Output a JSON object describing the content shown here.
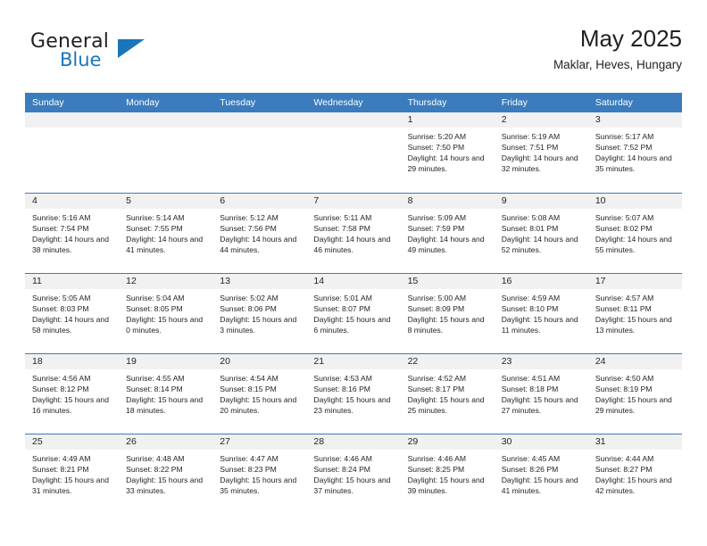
{
  "brand": {
    "line1": "General",
    "line2": "Blue",
    "logo_icon": "blue-triangle-flag-icon",
    "accent_color": "#1b75bb"
  },
  "header": {
    "title": "May 2025",
    "subtitle": "Maklar, Heves, Hungary"
  },
  "theme": {
    "header_blue": "#3a7cbe",
    "date_band": "#f1f1f1",
    "text": "#231f20"
  },
  "calendar": {
    "weekdays": [
      "Sunday",
      "Monday",
      "Tuesday",
      "Wednesday",
      "Thursday",
      "Friday",
      "Saturday"
    ],
    "weeks": [
      [
        {
          "day": ""
        },
        {
          "day": ""
        },
        {
          "day": ""
        },
        {
          "day": ""
        },
        {
          "day": "1",
          "sunrise": "Sunrise: 5:20 AM",
          "sunset": "Sunset: 7:50 PM",
          "daylight": "Daylight: 14 hours and 29 minutes."
        },
        {
          "day": "2",
          "sunrise": "Sunrise: 5:19 AM",
          "sunset": "Sunset: 7:51 PM",
          "daylight": "Daylight: 14 hours and 32 minutes."
        },
        {
          "day": "3",
          "sunrise": "Sunrise: 5:17 AM",
          "sunset": "Sunset: 7:52 PM",
          "daylight": "Daylight: 14 hours and 35 minutes."
        }
      ],
      [
        {
          "day": "4",
          "sunrise": "Sunrise: 5:16 AM",
          "sunset": "Sunset: 7:54 PM",
          "daylight": "Daylight: 14 hours and 38 minutes."
        },
        {
          "day": "5",
          "sunrise": "Sunrise: 5:14 AM",
          "sunset": "Sunset: 7:55 PM",
          "daylight": "Daylight: 14 hours and 41 minutes."
        },
        {
          "day": "6",
          "sunrise": "Sunrise: 5:12 AM",
          "sunset": "Sunset: 7:56 PM",
          "daylight": "Daylight: 14 hours and 44 minutes."
        },
        {
          "day": "7",
          "sunrise": "Sunrise: 5:11 AM",
          "sunset": "Sunset: 7:58 PM",
          "daylight": "Daylight: 14 hours and 46 minutes."
        },
        {
          "day": "8",
          "sunrise": "Sunrise: 5:09 AM",
          "sunset": "Sunset: 7:59 PM",
          "daylight": "Daylight: 14 hours and 49 minutes."
        },
        {
          "day": "9",
          "sunrise": "Sunrise: 5:08 AM",
          "sunset": "Sunset: 8:01 PM",
          "daylight": "Daylight: 14 hours and 52 minutes."
        },
        {
          "day": "10",
          "sunrise": "Sunrise: 5:07 AM",
          "sunset": "Sunset: 8:02 PM",
          "daylight": "Daylight: 14 hours and 55 minutes."
        }
      ],
      [
        {
          "day": "11",
          "sunrise": "Sunrise: 5:05 AM",
          "sunset": "Sunset: 8:03 PM",
          "daylight": "Daylight: 14 hours and 58 minutes."
        },
        {
          "day": "12",
          "sunrise": "Sunrise: 5:04 AM",
          "sunset": "Sunset: 8:05 PM",
          "daylight": "Daylight: 15 hours and 0 minutes."
        },
        {
          "day": "13",
          "sunrise": "Sunrise: 5:02 AM",
          "sunset": "Sunset: 8:06 PM",
          "daylight": "Daylight: 15 hours and 3 minutes."
        },
        {
          "day": "14",
          "sunrise": "Sunrise: 5:01 AM",
          "sunset": "Sunset: 8:07 PM",
          "daylight": "Daylight: 15 hours and 6 minutes."
        },
        {
          "day": "15",
          "sunrise": "Sunrise: 5:00 AM",
          "sunset": "Sunset: 8:09 PM",
          "daylight": "Daylight: 15 hours and 8 minutes."
        },
        {
          "day": "16",
          "sunrise": "Sunrise: 4:59 AM",
          "sunset": "Sunset: 8:10 PM",
          "daylight": "Daylight: 15 hours and 11 minutes."
        },
        {
          "day": "17",
          "sunrise": "Sunrise: 4:57 AM",
          "sunset": "Sunset: 8:11 PM",
          "daylight": "Daylight: 15 hours and 13 minutes."
        }
      ],
      [
        {
          "day": "18",
          "sunrise": "Sunrise: 4:56 AM",
          "sunset": "Sunset: 8:12 PM",
          "daylight": "Daylight: 15 hours and 16 minutes."
        },
        {
          "day": "19",
          "sunrise": "Sunrise: 4:55 AM",
          "sunset": "Sunset: 8:14 PM",
          "daylight": "Daylight: 15 hours and 18 minutes."
        },
        {
          "day": "20",
          "sunrise": "Sunrise: 4:54 AM",
          "sunset": "Sunset: 8:15 PM",
          "daylight": "Daylight: 15 hours and 20 minutes."
        },
        {
          "day": "21",
          "sunrise": "Sunrise: 4:53 AM",
          "sunset": "Sunset: 8:16 PM",
          "daylight": "Daylight: 15 hours and 23 minutes."
        },
        {
          "day": "22",
          "sunrise": "Sunrise: 4:52 AM",
          "sunset": "Sunset: 8:17 PM",
          "daylight": "Daylight: 15 hours and 25 minutes."
        },
        {
          "day": "23",
          "sunrise": "Sunrise: 4:51 AM",
          "sunset": "Sunset: 8:18 PM",
          "daylight": "Daylight: 15 hours and 27 minutes."
        },
        {
          "day": "24",
          "sunrise": "Sunrise: 4:50 AM",
          "sunset": "Sunset: 8:19 PM",
          "daylight": "Daylight: 15 hours and 29 minutes."
        }
      ],
      [
        {
          "day": "25",
          "sunrise": "Sunrise: 4:49 AM",
          "sunset": "Sunset: 8:21 PM",
          "daylight": "Daylight: 15 hours and 31 minutes."
        },
        {
          "day": "26",
          "sunrise": "Sunrise: 4:48 AM",
          "sunset": "Sunset: 8:22 PM",
          "daylight": "Daylight: 15 hours and 33 minutes."
        },
        {
          "day": "27",
          "sunrise": "Sunrise: 4:47 AM",
          "sunset": "Sunset: 8:23 PM",
          "daylight": "Daylight: 15 hours and 35 minutes."
        },
        {
          "day": "28",
          "sunrise": "Sunrise: 4:46 AM",
          "sunset": "Sunset: 8:24 PM",
          "daylight": "Daylight: 15 hours and 37 minutes."
        },
        {
          "day": "29",
          "sunrise": "Sunrise: 4:46 AM",
          "sunset": "Sunset: 8:25 PM",
          "daylight": "Daylight: 15 hours and 39 minutes."
        },
        {
          "day": "30",
          "sunrise": "Sunrise: 4:45 AM",
          "sunset": "Sunset: 8:26 PM",
          "daylight": "Daylight: 15 hours and 41 minutes."
        },
        {
          "day": "31",
          "sunrise": "Sunrise: 4:44 AM",
          "sunset": "Sunset: 8:27 PM",
          "daylight": "Daylight: 15 hours and 42 minutes."
        }
      ]
    ]
  }
}
